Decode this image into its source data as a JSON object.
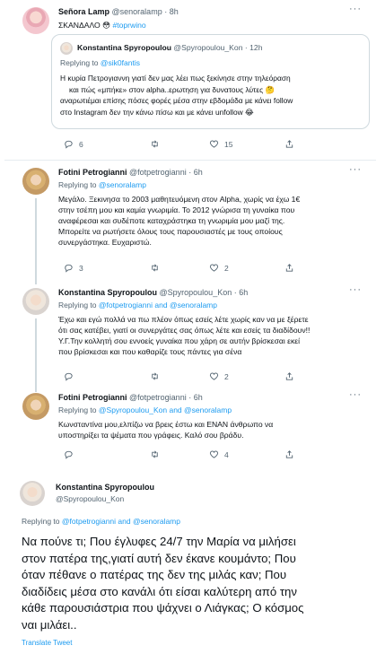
{
  "tweet1": {
    "name": "Señora Lamp",
    "handle": "@senoralamp",
    "time": "8h",
    "text": "ΣΚΑΝΔΑΛΟ 😳",
    "hashtag": "#toprwino",
    "quote": {
      "name": "Konstantina Spyropoulou",
      "handle": "@Spyropoulou_Kon",
      "time": "12h",
      "reply_prefix": "Replying to",
      "reply_to": "@sik0fantis",
      "lines": [
        "Η κυρία Πετρογιαννη γιατί δεν μας λέει πως ξεκίνησε στην τηλεόραση",
        "και πώς «μπήκε» στον alpha..ερωτηση για δυνατους λύτες 🤔",
        "αναρωτιέμαι επίσης πόσες φορές μέσα στην εβδομάδα με κάνει follow",
        "στο Instagram δεν την κάνω πίσω και με κάνει unfollow 😂"
      ]
    },
    "counts": {
      "reply": "6",
      "retweet": "",
      "like": "15",
      "share": ""
    }
  },
  "tweet2": {
    "name": "Fotini Petrogianni",
    "handle": "@fotpetrogianni",
    "time": "6h",
    "reply_prefix": "Replying to",
    "reply_to": "@senoralamp",
    "lines": [
      "Μεγάλο. Ξεκινησα το 2003 μαθητευόμενη στον Alpha, χωρίς να έχω 1€",
      "στην τσέπη μου και καμία γνωριμία. Το 2012 γνώρισα τη γυναίκα που",
      "αναφέρεσαι και συδέποτε καταχράστηκα τη γνωριμία μου μαζί της.",
      "Μπορείτε να ρωτήσετε όλους τους παρουσιαστές με τους οποίους",
      "συνεργάστηκα. Ευχαριστώ."
    ],
    "counts": {
      "reply": "3",
      "retweet": "",
      "like": "2",
      "share": ""
    }
  },
  "tweet3": {
    "name": "Konstantina Spyropoulou",
    "handle": "@Spyropoulou_Kon",
    "time": "6h",
    "reply_prefix": "Replying to",
    "reply_to": "@fotpetrogianni and @senoralamp",
    "lines": [
      "Έχω και εγώ πολλά να πω πλέον όπως εσείς λέτε χωρίς καν να με ξέρετε",
      "ότι σας κατέβει, γιατί οι συνεργάτες σας όπως λέτε και εσείς τα διαδίδουν!!",
      "Υ.Γ.Την κολλητή σου εννοείς γυναίκα που χάρη σε αυτήν βρίσκεσαι εκεί",
      "που βρίσκεσαι και που καθαρίζε τους πάντες για σένα"
    ],
    "counts": {
      "reply": "",
      "retweet": "",
      "like": "2",
      "share": ""
    }
  },
  "tweet4": {
    "name": "Fotini Petrogianni",
    "handle": "@fotpetrogianni",
    "time": "6h",
    "reply_prefix": "Replying to",
    "reply_to": "@Spyropoulou_Kon and @senoralamp",
    "lines": [
      "Κωνσταντίνα μου,ελπίζω να βρεις έστω και ΕΝΑΝ άνθρωπο να",
      "υποστηρίξει τα ψέματα που γράφεις. Καλό σου βράδυ."
    ],
    "counts": {
      "reply": "",
      "retweet": "",
      "like": "4",
      "share": ""
    }
  },
  "tweet5": {
    "name": "Konstantina Spyropoulou",
    "handle": "@Spyropoulou_Kon",
    "reply_prefix": "Replying to",
    "reply_to": "@fotpetrogianni and @senoralamp",
    "lines": [
      "Να πούνε τι; Που έγλυφες 24/7 την Μαρία να μιλήσει",
      "στον πατέρα της,γιατί αυτή δεν έκανε κουμάντο; Που",
      "όταν πέθανε ο πατέρας της δεν της μιλάς καν; Που",
      "διαδίδεις μέσα στο κανάλι ότι είσαι καλύτερη από την",
      "κάθε παρουσιάστρια που ψάχνει ο Λιάγκας; Ο κόσμος",
      "ναι μιλάει.."
    ],
    "translate": "Translate Tweet"
  },
  "icons": {
    "reply": "reply-icon",
    "retweet": "retweet-icon",
    "like": "heart-icon",
    "share": "share-icon",
    "more": "more-icon"
  },
  "colors": {
    "link": "#1d9bf0",
    "secondary": "#536471",
    "text": "#0f1419",
    "border": "#cfd9de"
  }
}
